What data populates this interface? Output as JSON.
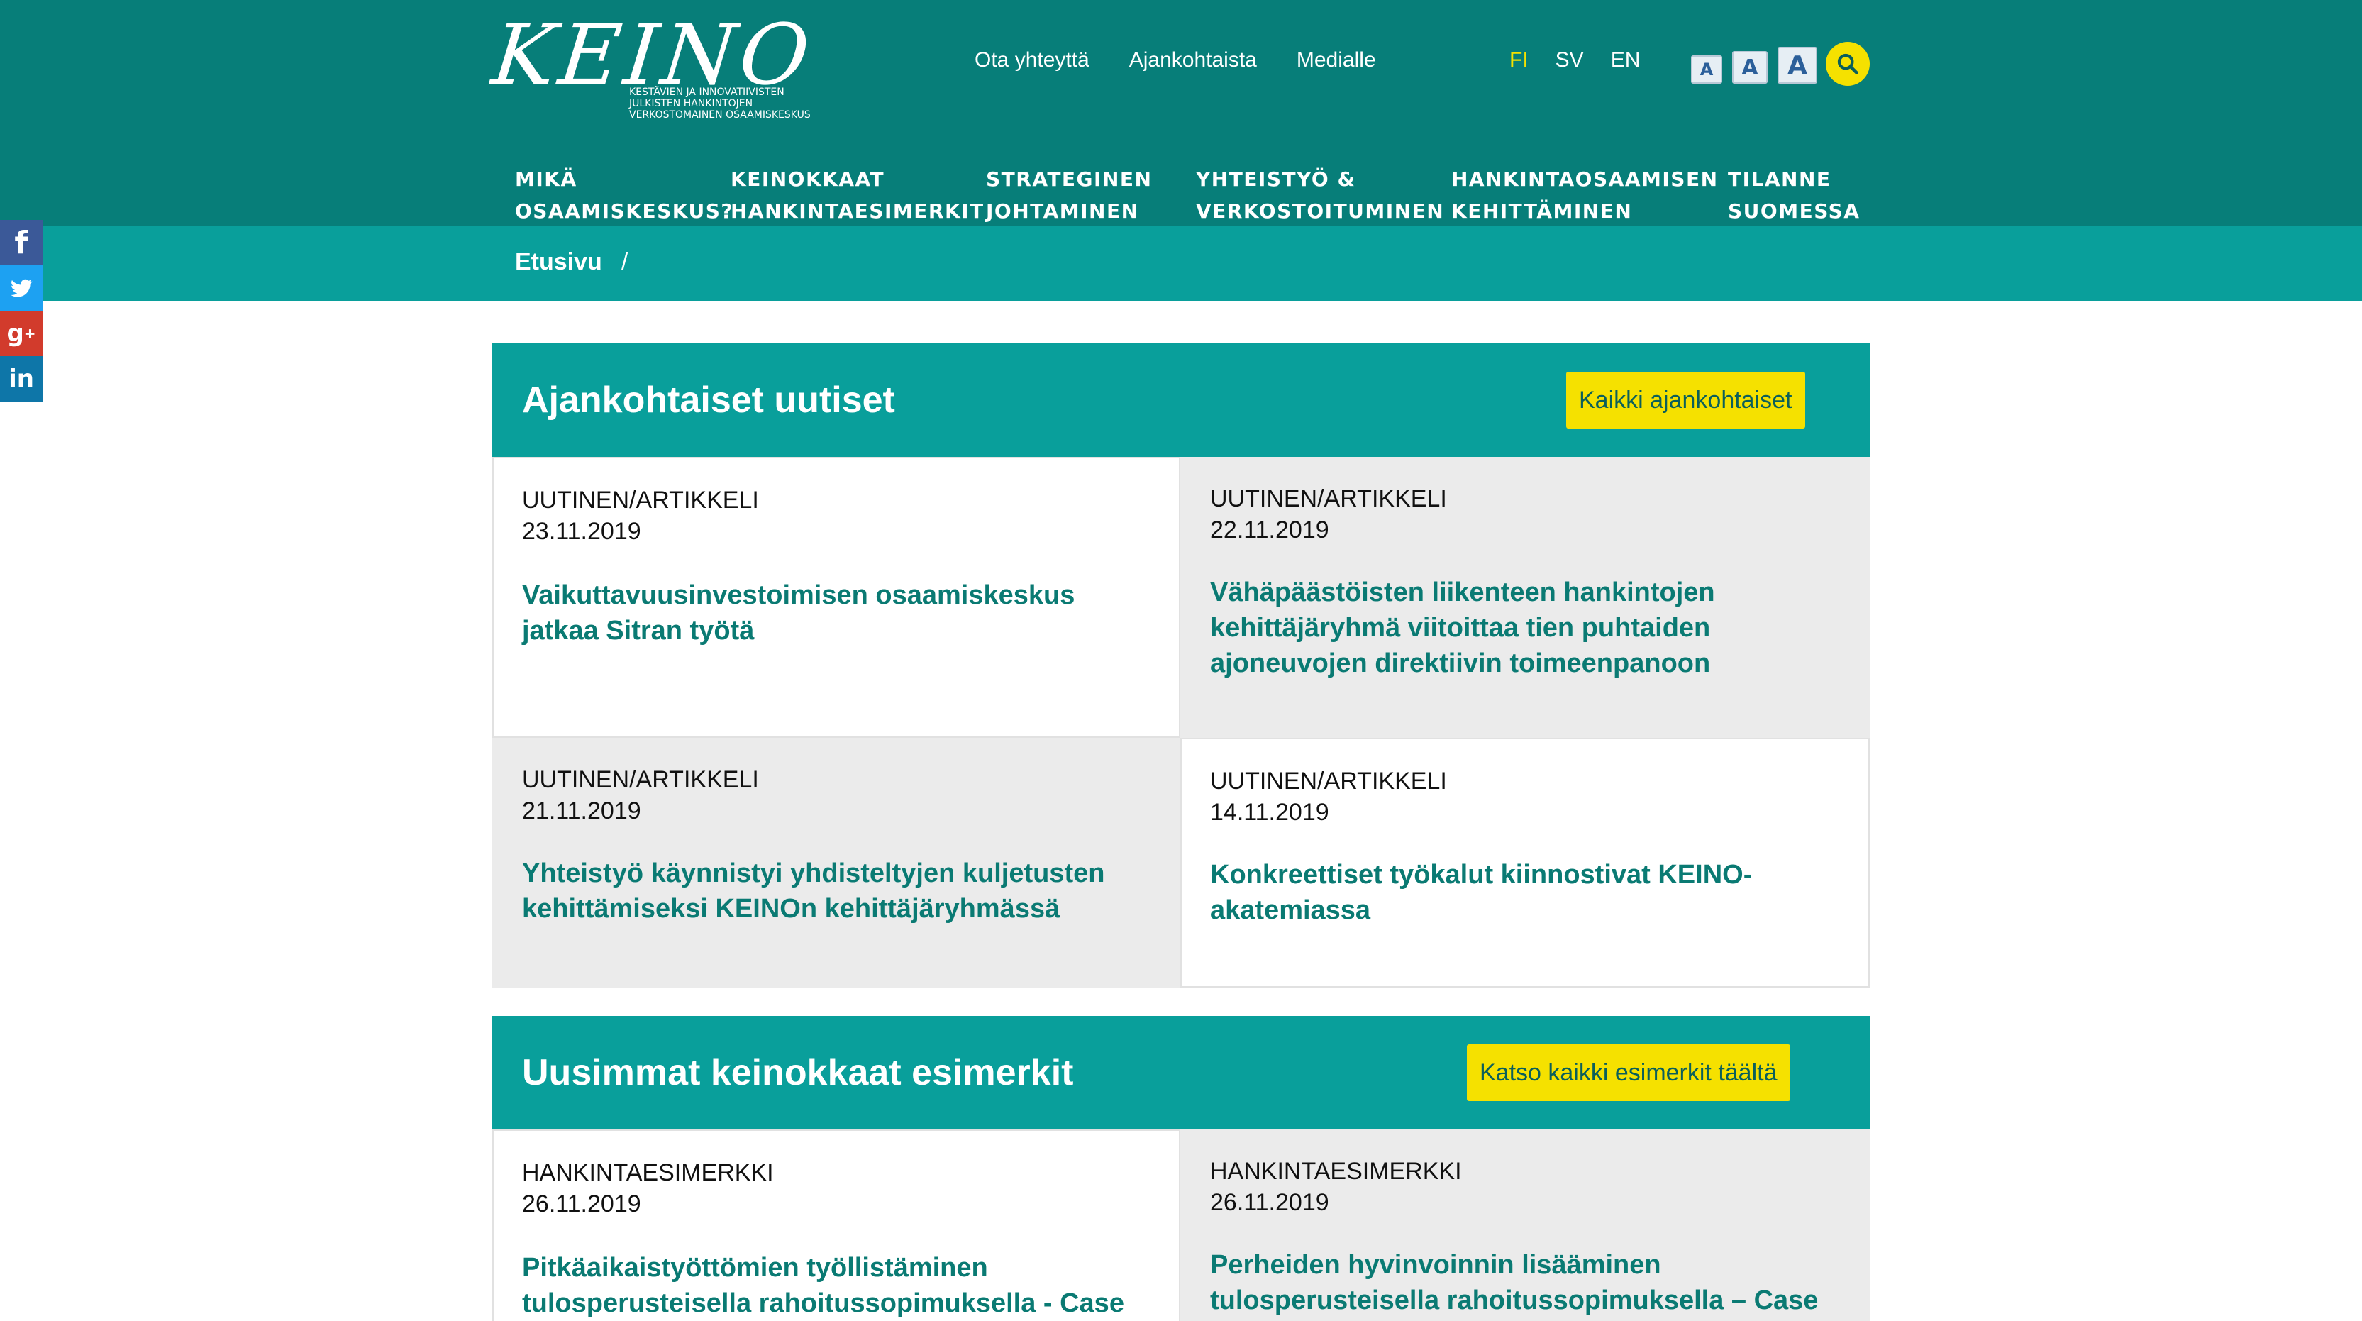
{
  "brand": {
    "logo_text": "KEINO",
    "tagline": [
      "KESTÄVIEN JA INNOVATIIVISTEN",
      "JULKISTEN HANKINTOJEN",
      "VERKOSTOMAINEN OSAAMISKESKUS"
    ]
  },
  "top_nav": {
    "items": [
      "Ota yhteyttä",
      "Ajankohtaista",
      "Medialle"
    ]
  },
  "languages": {
    "items": [
      "FI",
      "SV",
      "EN"
    ],
    "active": "FI"
  },
  "font_size": {
    "small": "A",
    "medium": "A",
    "large": "A"
  },
  "main_nav": {
    "items": [
      {
        "line1": "MIKÄ",
        "line2": "OSAAMISKESKUS?"
      },
      {
        "line1": "KEINOKKAAT",
        "line2": "HANKINTAESIMERKIT"
      },
      {
        "line1": "STRATEGINEN",
        "line2": "JOHTAMINEN"
      },
      {
        "line1": "YHTEISTYÖ &",
        "line2": "VERKOSTOITUMINEN"
      },
      {
        "line1": "HANKINTAOSAAMISEN",
        "line2": "KEHITTÄMINEN"
      },
      {
        "line1": "TILANNE",
        "line2": "SUOMESSA"
      }
    ]
  },
  "breadcrumb": {
    "home": "Etusivu",
    "separator": "/"
  },
  "social": [
    "facebook-icon",
    "twitter-icon",
    "google-plus-icon",
    "linkedin-icon"
  ],
  "news": {
    "title": "Ajankohtaiset uutiset",
    "button": "Kaikki ajankohtaiset",
    "items": [
      {
        "type": "UUTINEN/ARTIKKELI",
        "date": "23.11.2019",
        "headline": "Vaikuttavuusinvestoimisen osaamiskeskus jatkaa Sitran työtä"
      },
      {
        "type": "UUTINEN/ARTIKKELI",
        "date": "22.11.2019",
        "headline": "Vähäpäästöisten liikenteen hankintojen kehittäjäryhmä viitoittaa tien puhtaiden ajoneuvojen direktiivin toimeenpanoon"
      },
      {
        "type": "UUTINEN/ARTIKKELI",
        "date": "21.11.2019",
        "headline": "Yhteistyö käynnistyi yhdisteltyjen kuljetusten kehittämiseksi KEINOn kehittäjäryhmässä"
      },
      {
        "type": "UUTINEN/ARTIKKELI",
        "date": "14.11.2019",
        "headline": "Konkreettiset työkalut kiinnostivat KEINO-akatemiassa"
      }
    ]
  },
  "examples": {
    "title": "Uusimmat keinokkaat esimerkit",
    "button": "Katso kaikki esimerkit täältä",
    "items": [
      {
        "type": "HANKINTAESIMERKKI",
        "date": "26.11.2019",
        "headline": "Pitkäaikaistyöttömien työllistäminen tulosperusteisella rahoitussopimuksella - Case TEM"
      },
      {
        "type": "HANKINTAESIMERKKI",
        "date": "26.11.2019",
        "headline": "Perheiden hyvinvoinnin lisääminen tulosperusteisella rahoitussopimuksella – Case KL-"
      }
    ]
  },
  "colors": {
    "header": "#077e79",
    "band": "#099f9b",
    "accent": "#f5e100",
    "link": "#0a7a73",
    "card_gray": "#ebebeb"
  }
}
